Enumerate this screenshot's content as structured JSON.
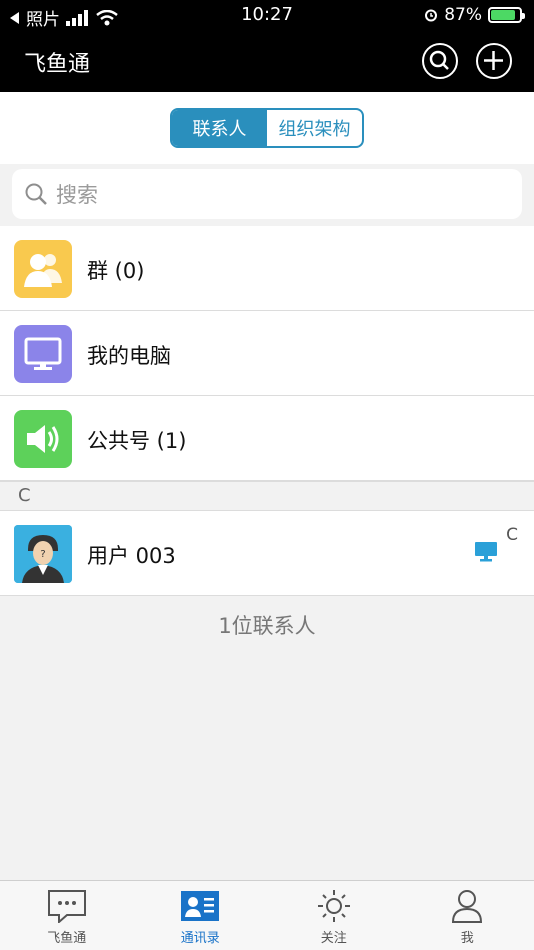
{
  "status_bar": {
    "back_label": "照片",
    "time": "10:27",
    "battery_percent": "87%",
    "battery_level": 0.87
  },
  "nav": {
    "title": "飞鱼通"
  },
  "segments": {
    "items": [
      {
        "label": "联系人",
        "active": true
      },
      {
        "label": "组织架构",
        "active": false
      }
    ]
  },
  "search": {
    "placeholder": "搜索"
  },
  "list": {
    "fixed_items": [
      {
        "label": "群 (0)",
        "icon": "group-icon",
        "color": "#f9c94e"
      },
      {
        "label": "我的电脑",
        "icon": "computer-icon",
        "color": "#8b84e9"
      },
      {
        "label": "公共号 (1)",
        "icon": "speaker-icon",
        "color": "#5dd15a"
      }
    ],
    "sections": [
      {
        "letter": "C",
        "contacts": [
          {
            "name": "用户 003",
            "status_letter": "C",
            "device": "desktop-icon"
          }
        ]
      }
    ],
    "count_text": "1位联系人"
  },
  "tabs": [
    {
      "label": "飞鱼通",
      "icon": "chat-icon",
      "active": false
    },
    {
      "label": "通讯录",
      "icon": "contacts-icon",
      "active": true
    },
    {
      "label": "关注",
      "icon": "sun-icon",
      "active": false
    },
    {
      "label": "我",
      "icon": "person-icon",
      "active": false
    }
  ],
  "colors": {
    "accent": "#2a8fbd",
    "tab_active": "#1a73c8"
  }
}
